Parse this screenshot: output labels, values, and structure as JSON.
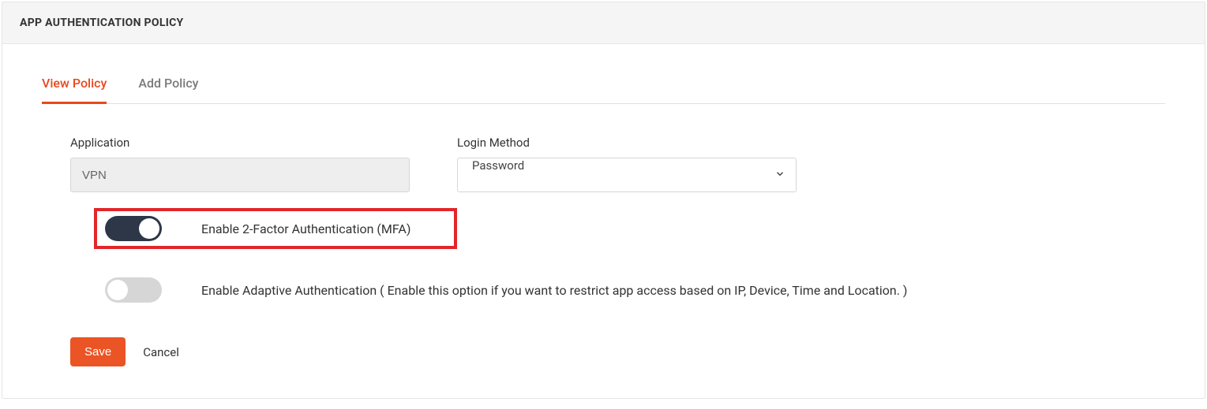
{
  "header": {
    "title": "APP AUTHENTICATION POLICY"
  },
  "tabs": [
    {
      "label": "View Policy",
      "active": true
    },
    {
      "label": "Add Policy",
      "active": false
    }
  ],
  "form": {
    "application_label": "Application",
    "application_value": "VPN",
    "login_method_label": "Login Method",
    "login_method_value": "Password"
  },
  "toggles": {
    "mfa": {
      "label": "Enable 2-Factor Authentication (MFA)",
      "on": true,
      "highlighted": true
    },
    "adaptive": {
      "label": "Enable Adaptive Authentication ( Enable this option if you want to restrict app access based on IP, Device, Time and Location. )",
      "on": false,
      "highlighted": false
    }
  },
  "actions": {
    "save": "Save",
    "cancel": "Cancel"
  },
  "colors": {
    "accent": "#eb5424",
    "highlight_border": "#e2262a",
    "toggle_on": "#2d3748",
    "toggle_off": "#d6d6d6"
  }
}
